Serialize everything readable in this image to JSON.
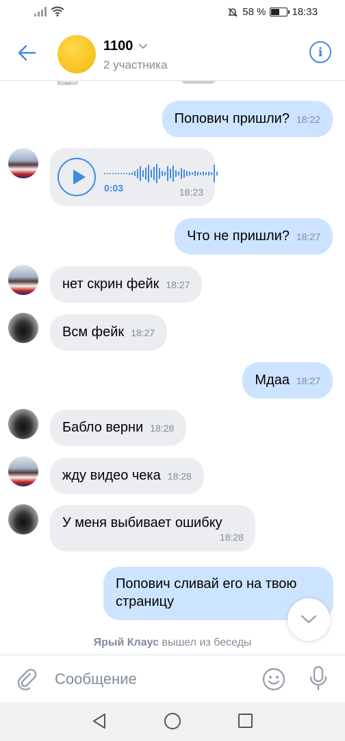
{
  "status_bar": {
    "signal": "signal-icon",
    "wifi": "wifi-icon",
    "mute": "bell-off-icon",
    "battery": "58 %",
    "battery_level": 0.58,
    "time": "18:33"
  },
  "header": {
    "title": "1100",
    "subtitle": "2 участника",
    "accent": "#3f8ae0"
  },
  "cut_off_text": "Комент",
  "voice_message": {
    "duration": "0:03",
    "time": "18:23"
  },
  "messages": [
    {
      "text": "Попович пришли?",
      "time": "18:22",
      "direction": "out"
    },
    {
      "text": "Что не пришли?",
      "time": "18:27",
      "direction": "out"
    },
    {
      "text": "нет скрин фейк",
      "time": "18:27",
      "direction": "in"
    },
    {
      "text": "Всм фейк",
      "time": "18:27",
      "direction": "in"
    },
    {
      "text": "Мдаа",
      "time": "18:27",
      "direction": "out"
    },
    {
      "text": "Бабло верни",
      "time": "18:28",
      "direction": "in"
    },
    {
      "text": "жду видео чека",
      "time": "18:28",
      "direction": "in"
    },
    {
      "text": "У меня выбивает ошибку",
      "time": "18:28",
      "direction": "in"
    },
    {
      "text": "Попович сливай его на твою страницу",
      "direction": "out"
    }
  ],
  "system_message": {
    "name": "Ярый Клаус",
    "action": " вышел из беседы"
  },
  "composer": {
    "placeholder": "Сообщение"
  },
  "colors": {
    "incoming_bubble": "#ebedf0",
    "outgoing_bubble": "#cce4ff",
    "meta_text": "#818c99"
  }
}
